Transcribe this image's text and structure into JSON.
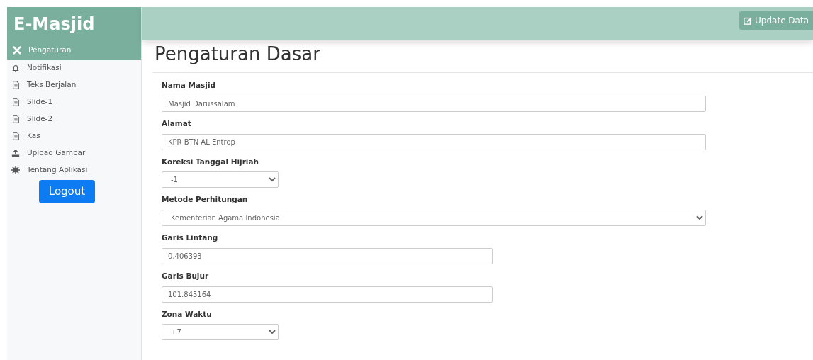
{
  "brand": "E-Masjid",
  "sidebar": {
    "items": [
      {
        "label": "Pengaturan",
        "selected": true
      },
      {
        "label": "Notifikasi",
        "selected": false
      },
      {
        "label": "Teks Berjalan",
        "selected": false
      },
      {
        "label": "Slide-1",
        "selected": false
      },
      {
        "label": "Slide-2",
        "selected": false
      },
      {
        "label": "Kas",
        "selected": false
      },
      {
        "label": "Upload Gambar",
        "selected": false
      },
      {
        "label": "Tentang Aplikasi",
        "selected": false
      }
    ],
    "logout": "Logout"
  },
  "toolbar": {
    "update_button": "Update Data"
  },
  "page_title": "Pengaturan Dasar",
  "fields": [
    {
      "label": "Nama Masjid",
      "kind": "text",
      "value": "Masjid Darussalam"
    },
    {
      "label": "Alamat",
      "kind": "text",
      "value": "KPR BTN AL Entrop"
    },
    {
      "label": "Koreksi Tanggal Hijriah",
      "kind": "select",
      "value": "-1"
    },
    {
      "label": "Metode Perhitungan",
      "kind": "select",
      "value": "Kementerian Agama Indonesia"
    },
    {
      "label": "Garis Lintang",
      "kind": "text",
      "value": "0.406393"
    },
    {
      "label": "Garis Bujur",
      "kind": "text",
      "value": "101.845164"
    },
    {
      "label": "Zona Waktu",
      "kind": "select",
      "value": "+7"
    }
  ]
}
